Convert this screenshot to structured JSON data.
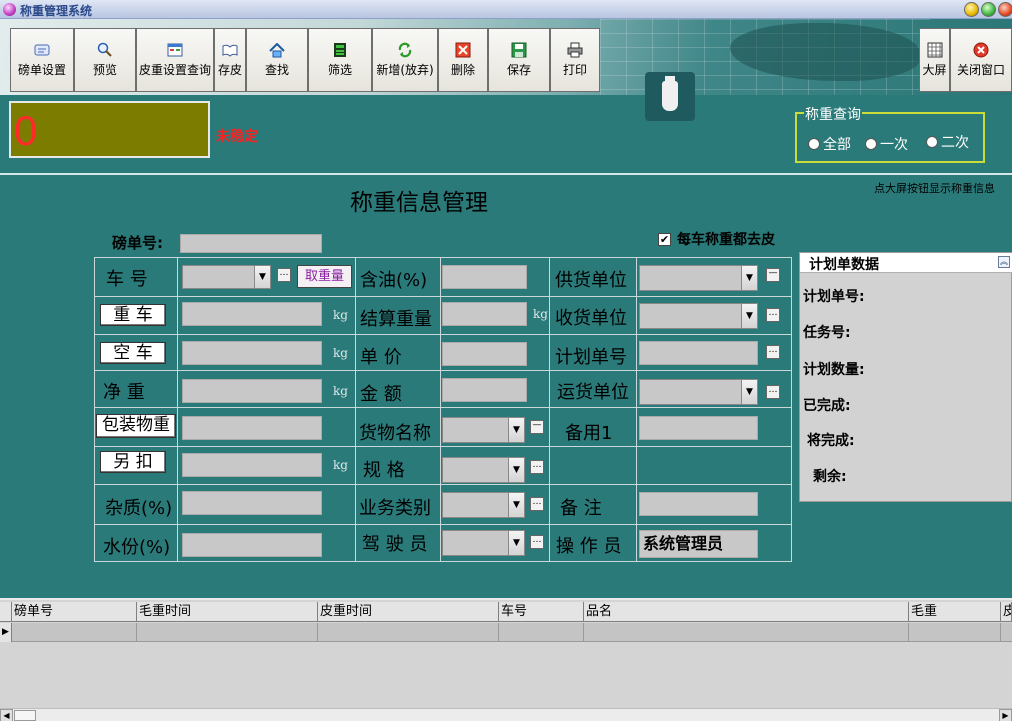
{
  "window": {
    "title": "称重管理系统"
  },
  "toolbar": {
    "weigh_settings": "磅单设置",
    "preview": "预览",
    "tare_query": "皮重设置查询",
    "save_tare": "存皮",
    "find": "查找",
    "filter": "筛选",
    "add_new": "新增(放弃)",
    "delete": "删除",
    "save": "保存",
    "print": "打印",
    "big_screen": "大屏",
    "close_window": "关闭窗口"
  },
  "display": {
    "weight": "0",
    "status": "未稳定"
  },
  "query": {
    "legend": "称重查询",
    "options": [
      "全部",
      "一次",
      "二次"
    ]
  },
  "hint": "点大屏按钮显示称重信息",
  "page_title": "称重信息管理",
  "ticket_label": "磅单号:",
  "tare_each_time": "每车称重都去皮",
  "form": {
    "car_no": "车  号",
    "get_weight": "取重量",
    "gross": "重  车",
    "empty": "空  车",
    "net": "净  重",
    "pack_weight": "包装物重",
    "extra_deduct": "另  扣",
    "impurity": "杂质(%)",
    "moisture": "水份(%)",
    "oil": "含油(%)",
    "settle_weight": "结算重量",
    "unit_price": "单   价",
    "amount": "金   额",
    "goods_name": "货物名称",
    "spec": "规   格",
    "biz_type": "业务类别",
    "driver": "驾 驶 员",
    "supplier": "供货单位",
    "receiver": "收货单位",
    "plan_no": "计划单号",
    "carrier": "运货单位",
    "spare1": "备用1",
    "remark": "备   注",
    "operator": "操 作 员",
    "operator_value": "系统管理员",
    "unit": "kg"
  },
  "plan_panel": {
    "title": "计划单数据",
    "plan_no": "计划单号:",
    "task_no": "任务号:",
    "plan_qty": "计划数量:",
    "completed": "已完成:",
    "to_complete": "将完成:",
    "remaining": "剩余:"
  },
  "grid": {
    "columns": [
      "磅单号",
      "毛重时间",
      "皮重时间",
      "车号",
      "品名",
      "毛重",
      "皮"
    ]
  },
  "colors": {
    "background": "#2b7a7a",
    "weight_bg": "#7c7c00",
    "weight_text": "#ff2a2a",
    "status": "#ff2020"
  }
}
